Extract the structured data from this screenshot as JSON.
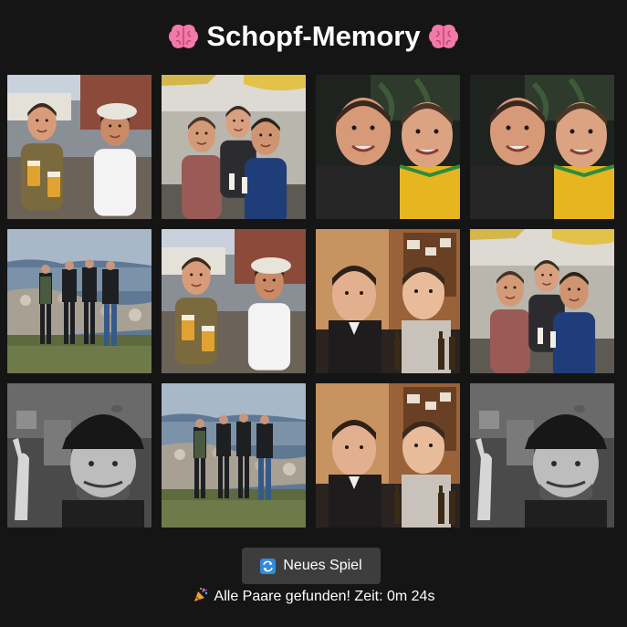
{
  "header": {
    "title": "Schopf-Memory",
    "left_icon": "brain-icon",
    "right_icon": "brain-icon"
  },
  "board": {
    "rows": 3,
    "columns": 4,
    "cards": [
      {
        "photo": "beer-toast-harbor",
        "state": "matched"
      },
      {
        "photo": "terrace-group",
        "state": "matched"
      },
      {
        "photo": "two-friends-closeup",
        "state": "matched"
      },
      {
        "photo": "two-friends-closeup",
        "state": "matched"
      },
      {
        "photo": "beach-group",
        "state": "matched"
      },
      {
        "photo": "beer-toast-harbor",
        "state": "matched"
      },
      {
        "photo": "pub-beer-bottles",
        "state": "matched"
      },
      {
        "photo": "terrace-group",
        "state": "matched"
      },
      {
        "photo": "helmet-bw",
        "state": "matched"
      },
      {
        "photo": "beach-group",
        "state": "matched"
      },
      {
        "photo": "pub-beer-bottles",
        "state": "matched"
      },
      {
        "photo": "helmet-bw",
        "state": "matched"
      }
    ]
  },
  "controls": {
    "new_game_label": "Neues Spiel",
    "new_game_icon": "refresh-icon"
  },
  "status": {
    "icon": "party-popper-icon",
    "text": "Alle Paare gefunden! Zeit: 0m 24s"
  },
  "colors": {
    "background": "#151515",
    "button": "#3d3d3d",
    "icon_blue": "#2f8ae0",
    "brain_pink": "#f27aa8"
  }
}
